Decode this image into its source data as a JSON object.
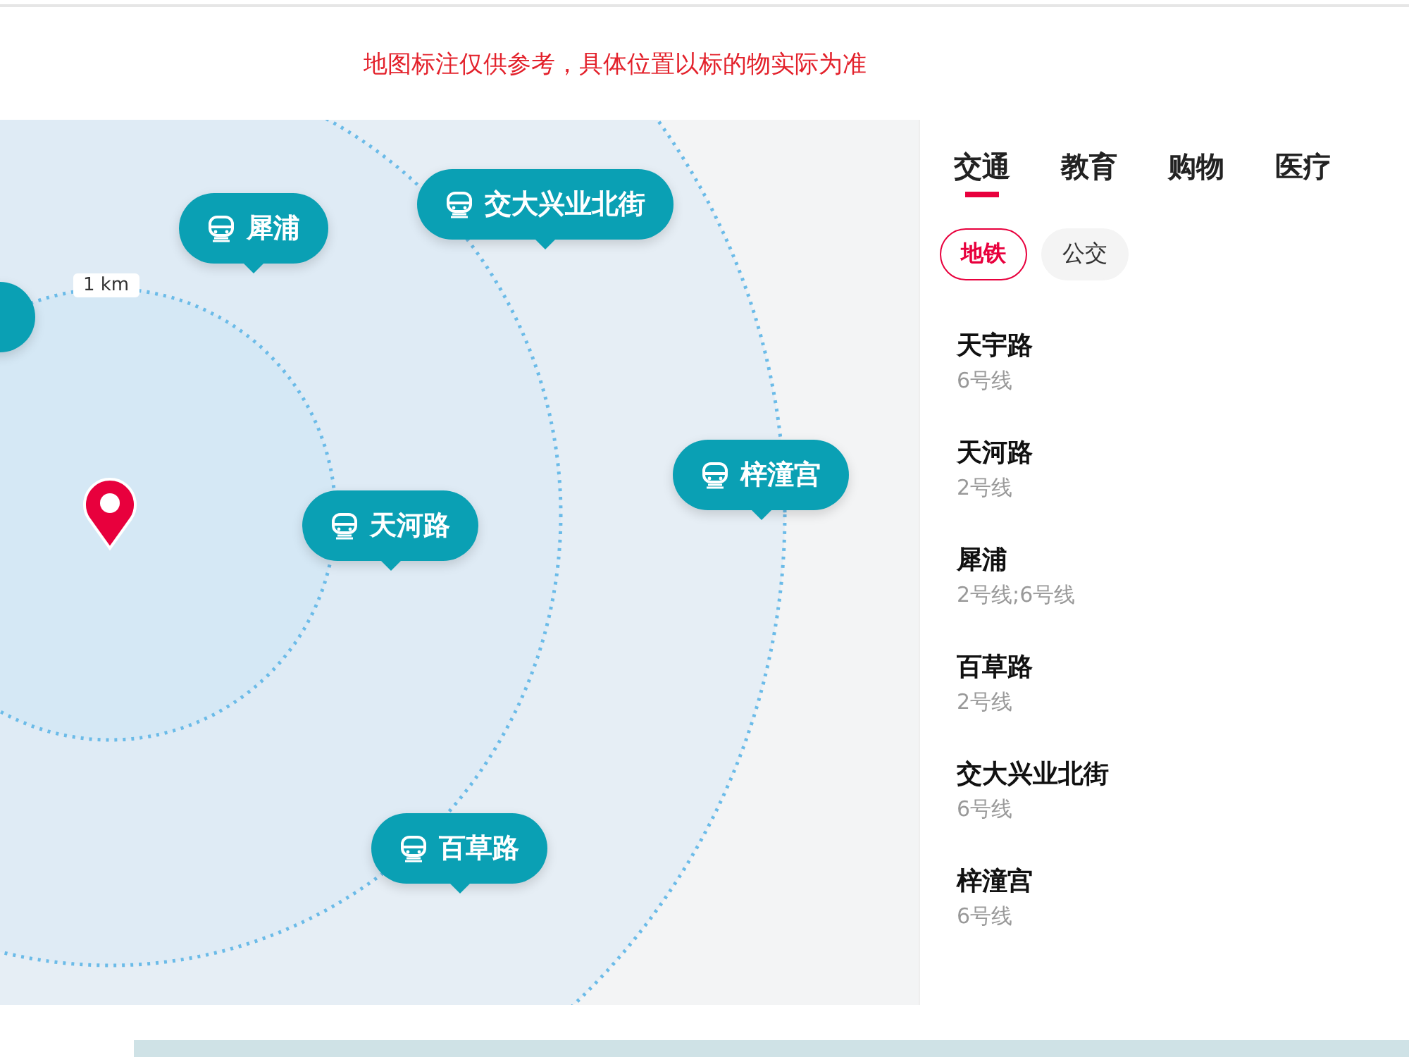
{
  "notice": "地图标注仅供参考，具体位置以标的物实际为准",
  "map": {
    "distance_label": "1 km",
    "stations": [
      {
        "name": "犀浦"
      },
      {
        "name": "交大兴业北街"
      },
      {
        "name": "天河路"
      },
      {
        "name": "梓潼宫"
      },
      {
        "name": "百草路"
      }
    ]
  },
  "tabs": [
    {
      "label": "交通",
      "selected": true
    },
    {
      "label": "教育",
      "selected": false
    },
    {
      "label": "购物",
      "selected": false
    },
    {
      "label": "医疗",
      "selected": false
    }
  ],
  "filters": [
    {
      "label": "地铁",
      "selected": true
    },
    {
      "label": "公交",
      "selected": false
    }
  ],
  "stations": [
    {
      "name": "天宇路",
      "lines": "6号线"
    },
    {
      "name": "天河路",
      "lines": "2号线"
    },
    {
      "name": "犀浦",
      "lines": "2号线;6号线"
    },
    {
      "name": "百草路",
      "lines": "2号线"
    },
    {
      "name": "交大兴业北街",
      "lines": "6号线"
    },
    {
      "name": "梓潼宫",
      "lines": "6号线"
    }
  ]
}
